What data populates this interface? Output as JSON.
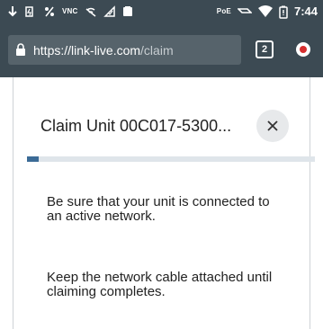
{
  "status_bar": {
    "icons": [
      "download-arrow-icon",
      "battery-charging-icon",
      "percent-icon",
      "vnc-icon",
      "wifi-off-icon",
      "signal-check-icon",
      "tablet-icon"
    ],
    "vnc_label": "VNC",
    "poe_label": "PoE",
    "time": "7:44"
  },
  "browser": {
    "url_host": "https://link-live.com",
    "url_path": "/claim",
    "tab_count": "2"
  },
  "dialog": {
    "title": "Claim Unit 00C017-5300...",
    "progress_fraction": 0.04,
    "message_1": "Be sure that your unit is connected to an active network.",
    "message_2": "Keep the network cable attached until claiming completes."
  },
  "colors": {
    "toolbar": "#3c4a53",
    "url_field": "#56636b",
    "progress_fill": "#3b6b96",
    "progress_track": "#dfe5ea",
    "close_bg": "#e7e9eb"
  }
}
